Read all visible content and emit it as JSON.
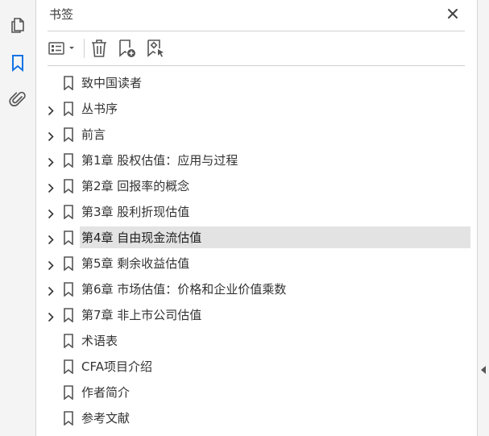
{
  "rail": {
    "icons": [
      "pages-icon",
      "bookmark-icon",
      "attachment-icon"
    ],
    "accent": "#1473e6"
  },
  "panel": {
    "title": "书签"
  },
  "toolbar": {
    "tools": [
      "options-menu-icon",
      "delete-bookmark-icon",
      "new-bookmark-icon",
      "bookmark-from-selection-icon"
    ]
  },
  "bookmarks": [
    {
      "label": "致中国读者",
      "expandable": false,
      "selected": false
    },
    {
      "label": "丛书序",
      "expandable": true,
      "selected": false
    },
    {
      "label": "前言",
      "expandable": true,
      "selected": false
    },
    {
      "label": "第1章 股权估值：应用与过程",
      "expandable": true,
      "selected": false
    },
    {
      "label": "第2章 回报率的概念",
      "expandable": true,
      "selected": false
    },
    {
      "label": "第3章 股利折现估值",
      "expandable": true,
      "selected": false
    },
    {
      "label": "第4章 自由现金流估值",
      "expandable": true,
      "selected": true
    },
    {
      "label": "第5章 剩余收益估值",
      "expandable": true,
      "selected": false
    },
    {
      "label": "第6章 市场估值：价格和企业价值乘数",
      "expandable": true,
      "selected": false
    },
    {
      "label": "第7章 非上市公司估值",
      "expandable": true,
      "selected": false
    },
    {
      "label": "术语表",
      "expandable": false,
      "selected": false
    },
    {
      "label": "CFA项目介绍",
      "expandable": false,
      "selected": false
    },
    {
      "label": "作者简介",
      "expandable": false,
      "selected": false
    },
    {
      "label": "参考文献",
      "expandable": false,
      "selected": false
    }
  ],
  "colors": {
    "selected_row": "#e3e3e3",
    "icon": "#555555"
  }
}
